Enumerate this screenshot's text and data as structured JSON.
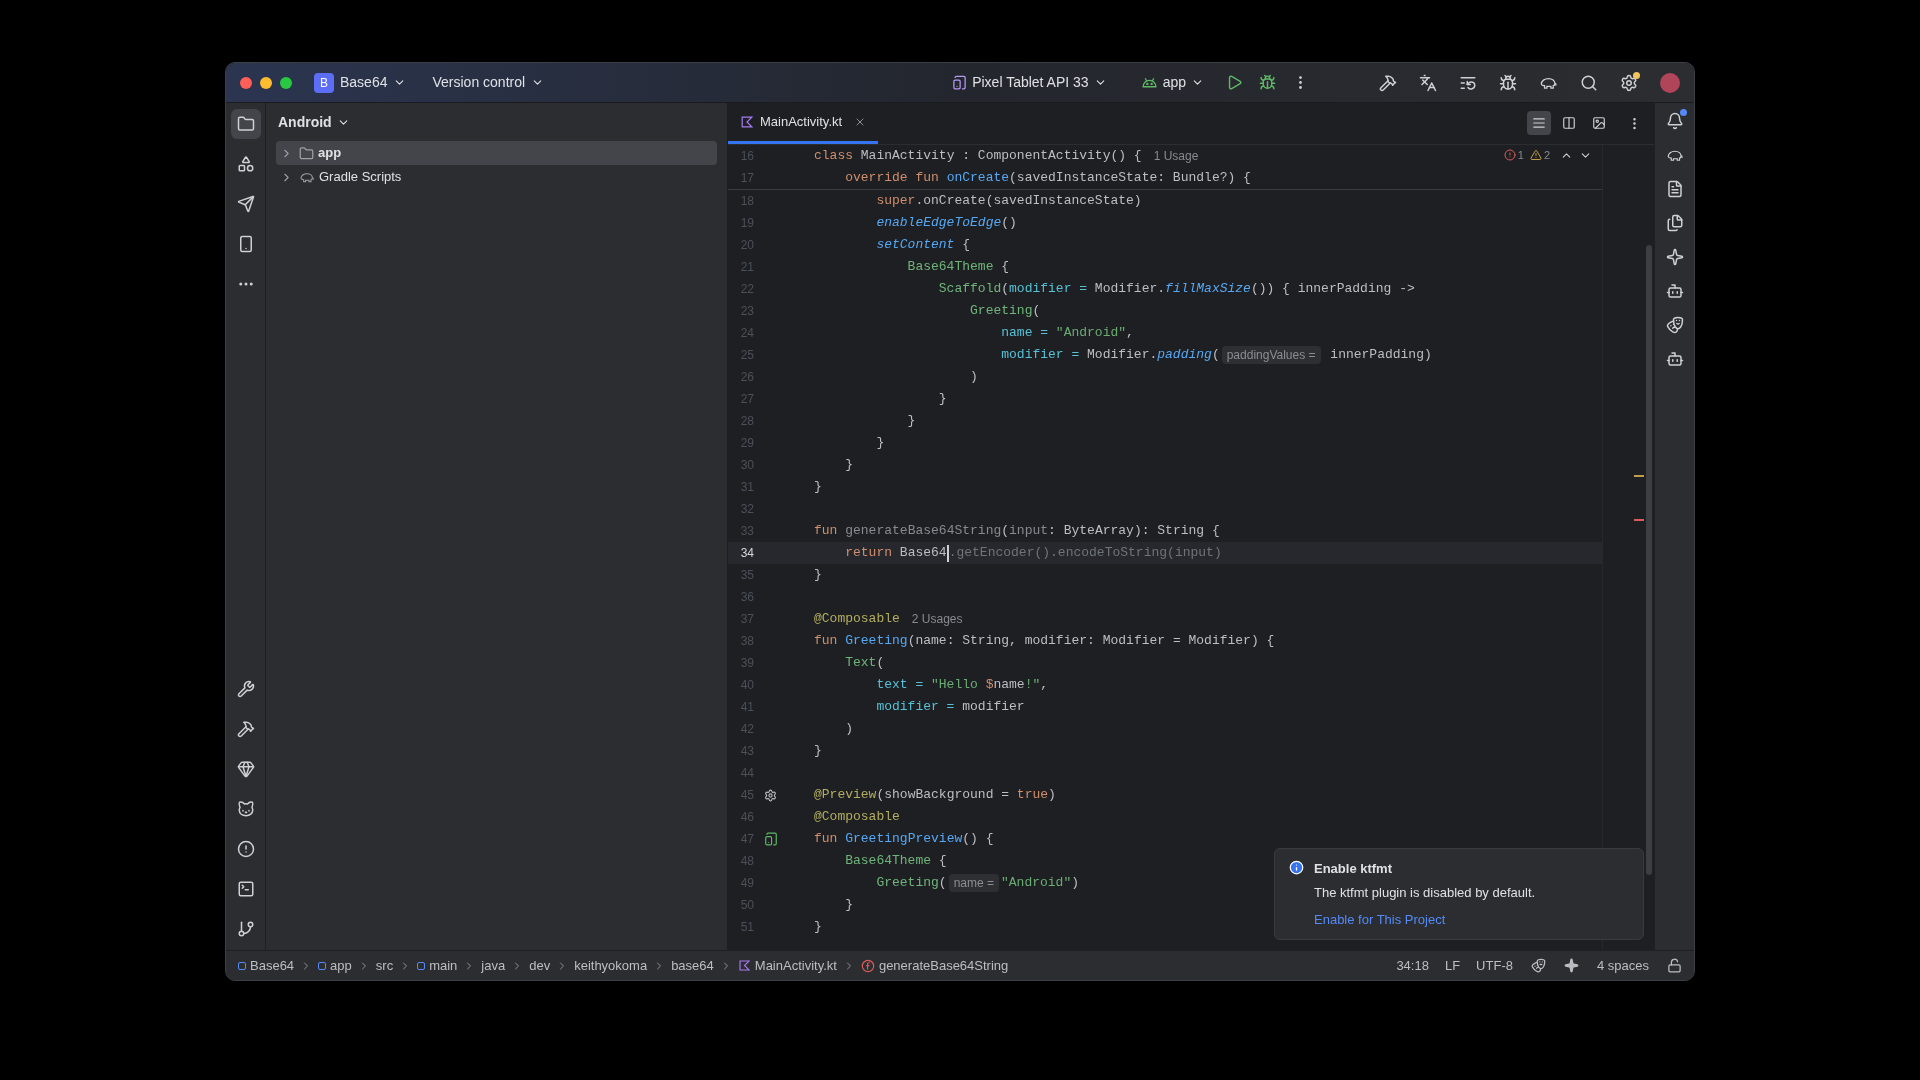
{
  "window": {
    "project": {
      "badge": "B",
      "name": "Base64"
    },
    "vcs": "Version control",
    "device": "Pixel Tablet API 33",
    "run_config": "app"
  },
  "left_strip": {
    "top": [
      {
        "kind": "project",
        "selected": true
      },
      {
        "kind": "resources",
        "selected": false
      },
      {
        "kind": "commit",
        "selected": false
      },
      {
        "kind": "device",
        "selected": false
      },
      {
        "kind": "more",
        "selected": false
      }
    ],
    "bottom": [
      {
        "kind": "build",
        "selected": false
      },
      {
        "kind": "hammer",
        "selected": false
      },
      {
        "kind": "gem",
        "selected": false
      },
      {
        "kind": "cat",
        "selected": false
      },
      {
        "kind": "problems",
        "selected": false
      },
      {
        "kind": "terminal",
        "selected": false
      },
      {
        "kind": "git",
        "selected": false
      }
    ]
  },
  "right_strip": [
    {
      "kind": "notifications",
      "badge": true
    },
    {
      "kind": "gradle",
      "badge": false
    },
    {
      "kind": "device_manager",
      "badge": false
    },
    {
      "kind": "files",
      "badge": false
    },
    {
      "kind": "gemini",
      "badge": false
    },
    {
      "kind": "bot",
      "badge": false
    },
    {
      "kind": "copilot",
      "badge": false
    },
    {
      "kind": "copilot_chat",
      "badge": false
    }
  ],
  "project_panel": {
    "title": "Android",
    "tree": [
      {
        "label": "app",
        "kind": "module",
        "selected": true,
        "expanded": false
      },
      {
        "label": "Gradle Scripts",
        "kind": "gradle",
        "selected": false,
        "expanded": false
      }
    ]
  },
  "editor": {
    "tabs": [
      {
        "label": "MainActivity.kt",
        "selected": true
      }
    ],
    "view_modes": [
      {
        "kind": "code",
        "selected": true
      },
      {
        "kind": "split",
        "selected": false
      },
      {
        "kind": "design",
        "selected": false
      }
    ],
    "inspections": {
      "errors": "1",
      "warnings": "2"
    },
    "sticky_lines": [
      {
        "number": "16",
        "tokens": [
          {
            "kind": "kw",
            "text": "class "
          },
          {
            "kind": "plain",
            "text": "MainActivity : ComponentActivity() {"
          },
          {
            "kind": "usage",
            "text": "1 Usage"
          }
        ]
      },
      {
        "number": "17",
        "tokens": [
          {
            "kind": "kw",
            "text": "    override fun "
          },
          {
            "kind": "fdecl",
            "text": "onCreate"
          },
          {
            "kind": "plain",
            "text": "(savedInstanceState: Bundle?) {"
          }
        ]
      }
    ],
    "lines": [
      {
        "number": "18",
        "current": false,
        "tokens": [
          {
            "kind": "kw",
            "text": "        super"
          },
          {
            "kind": "plain",
            "text": ".onCreate(savedInstanceState)"
          }
        ]
      },
      {
        "number": "19",
        "current": false,
        "tokens": [
          {
            "kind": "fcall",
            "text": "        enableEdgeToEdge"
          },
          {
            "kind": "plain",
            "text": "()"
          }
        ]
      },
      {
        "number": "20",
        "current": false,
        "tokens": [
          {
            "kind": "fcall",
            "text": "        setContent"
          },
          {
            "kind": "plain",
            "text": " {"
          }
        ]
      },
      {
        "number": "21",
        "current": false,
        "tokens": [
          {
            "kind": "comp",
            "text": "            Base64Theme"
          },
          {
            "kind": "plain",
            "text": " {"
          }
        ]
      },
      {
        "number": "22",
        "current": false,
        "tokens": [
          {
            "kind": "comp",
            "text": "                Scaffold"
          },
          {
            "kind": "plain",
            "text": "("
          },
          {
            "kind": "arg",
            "text": "modifier ="
          },
          {
            "kind": "plain",
            "text": " Modifier."
          },
          {
            "kind": "fcall",
            "text": "fillMaxSize"
          },
          {
            "kind": "plain",
            "text": "()) { innerPadding ->"
          }
        ]
      },
      {
        "number": "23",
        "current": false,
        "tokens": [
          {
            "kind": "comp",
            "text": "                    Greeting"
          },
          {
            "kind": "plain",
            "text": "("
          }
        ]
      },
      {
        "number": "24",
        "current": false,
        "tokens": [
          {
            "kind": "arg",
            "text": "                        name ="
          },
          {
            "kind": "str",
            "text": " \"Android\""
          },
          {
            "kind": "plain",
            "text": ","
          }
        ]
      },
      {
        "number": "25",
        "current": false,
        "tokens": [
          {
            "kind": "arg",
            "text": "                        modifier ="
          },
          {
            "kind": "plain",
            "text": " Modifier."
          },
          {
            "kind": "fcall",
            "text": "padding"
          },
          {
            "kind": "plain",
            "text": "("
          },
          {
            "kind": "hint",
            "text": "paddingValues ="
          },
          {
            "kind": "plain",
            "text": " innerPadding)"
          }
        ]
      },
      {
        "number": "26",
        "current": false,
        "tokens": [
          {
            "kind": "plain",
            "text": "                    )"
          }
        ]
      },
      {
        "number": "27",
        "current": false,
        "tokens": [
          {
            "kind": "plain",
            "text": "                }"
          }
        ]
      },
      {
        "number": "28",
        "current": false,
        "tokens": [
          {
            "kind": "plain",
            "text": "            }"
          }
        ]
      },
      {
        "number": "29",
        "current": false,
        "tokens": [
          {
            "kind": "plain",
            "text": "        }"
          }
        ]
      },
      {
        "number": "30",
        "current": false,
        "tokens": [
          {
            "kind": "plain",
            "text": "    }"
          }
        ]
      },
      {
        "number": "31",
        "current": false,
        "tokens": [
          {
            "kind": "plain",
            "text": "}"
          }
        ]
      },
      {
        "number": "32",
        "current": false
      },
      {
        "number": "33",
        "current": false,
        "tokens": [
          {
            "kind": "kw",
            "text": "fun "
          },
          {
            "kind": "dim",
            "text": "generateBase64String"
          },
          {
            "kind": "plain",
            "text": "("
          },
          {
            "kind": "dim",
            "text": "input"
          },
          {
            "kind": "plain",
            "text": ": ByteArray): String {"
          }
        ]
      },
      {
        "number": "34",
        "current": true,
        "tokens": [
          {
            "kind": "kw",
            "text": "    return "
          },
          {
            "kind": "plain",
            "text": "Base64"
          },
          {
            "kind": "cursor"
          },
          {
            "kind": "gray",
            "text": ".getEncoder().encodeToString(input)"
          }
        ]
      },
      {
        "number": "35",
        "current": false,
        "tokens": [
          {
            "kind": "plain",
            "text": "}"
          }
        ]
      },
      {
        "number": "36",
        "current": false
      },
      {
        "number": "37",
        "current": false,
        "tokens": [
          {
            "kind": "ann",
            "text": "@Composable"
          },
          {
            "kind": "usage",
            "text": "2 Usages"
          }
        ]
      },
      {
        "number": "38",
        "current": false,
        "tokens": [
          {
            "kind": "kw",
            "text": "fun "
          },
          {
            "kind": "fdecl",
            "text": "Greeting"
          },
          {
            "kind": "plain",
            "text": "(name: String, modifier: Modifier = Modifier) {"
          }
        ]
      },
      {
        "number": "39",
        "current": false,
        "tokens": [
          {
            "kind": "comp",
            "text": "    Text"
          },
          {
            "kind": "plain",
            "text": "("
          }
        ]
      },
      {
        "number": "40",
        "current": false,
        "tokens": [
          {
            "kind": "arg",
            "text": "        text ="
          },
          {
            "kind": "str",
            "text": " \"Hello "
          },
          {
            "kind": "kw",
            "text": "$"
          },
          {
            "kind": "plain",
            "text": "name"
          },
          {
            "kind": "str",
            "text": "!\""
          },
          {
            "kind": "plain",
            "text": ","
          }
        ]
      },
      {
        "number": "41",
        "current": false,
        "tokens": [
          {
            "kind": "arg",
            "text": "        modifier ="
          },
          {
            "kind": "plain",
            "text": " modifier"
          }
        ]
      },
      {
        "number": "42",
        "current": false,
        "tokens": [
          {
            "kind": "plain",
            "text": "    )"
          }
        ]
      },
      {
        "number": "43",
        "current": false,
        "tokens": [
          {
            "kind": "plain",
            "text": "}"
          }
        ]
      },
      {
        "number": "44",
        "current": false
      },
      {
        "number": "45",
        "current": false,
        "gutter": {
          "kind": "settings"
        },
        "tokens": [
          {
            "kind": "ann",
            "text": "@Preview"
          },
          {
            "kind": "plain",
            "text": "(showBackground = "
          },
          {
            "kind": "kw",
            "text": "true"
          },
          {
            "kind": "plain",
            "text": ")"
          }
        ]
      },
      {
        "number": "46",
        "current": false,
        "tokens": [
          {
            "kind": "ann",
            "text": "@Composable"
          }
        ]
      },
      {
        "number": "47",
        "current": false,
        "gutter": {
          "kind": "preview"
        },
        "tokens": [
          {
            "kind": "kw",
            "text": "fun "
          },
          {
            "kind": "fdecl",
            "text": "GreetingPreview"
          },
          {
            "kind": "plain",
            "text": "() {"
          }
        ]
      },
      {
        "number": "48",
        "current": false,
        "tokens": [
          {
            "kind": "comp",
            "text": "    Base64Theme"
          },
          {
            "kind": "plain",
            "text": " {"
          }
        ]
      },
      {
        "number": "49",
        "current": false,
        "tokens": [
          {
            "kind": "comp",
            "text": "        Greeting"
          },
          {
            "kind": "plain",
            "text": "("
          },
          {
            "kind": "hint",
            "text": "name ="
          },
          {
            "kind": "str",
            "text": "\"Android\""
          },
          {
            "kind": "plain",
            "text": ")"
          }
        ]
      },
      {
        "number": "50",
        "current": false,
        "tokens": [
          {
            "kind": "plain",
            "text": "    }"
          }
        ]
      },
      {
        "number": "51",
        "current": false,
        "tokens": [
          {
            "kind": "plain",
            "text": "}"
          }
        ]
      }
    ]
  },
  "notification": {
    "title": "Enable ktfmt",
    "message": "The ktfmt plugin is disabled by default.",
    "action": "Enable for This Project"
  },
  "status_bar": {
    "breadcrumbs": [
      {
        "label": "Base64",
        "kind": "module"
      },
      {
        "label": "app",
        "kind": "module"
      },
      {
        "label": "src",
        "kind": "folder"
      },
      {
        "label": "main",
        "kind": "module"
      },
      {
        "label": "java",
        "kind": "folder"
      },
      {
        "label": "dev",
        "kind": "folder"
      },
      {
        "label": "keithyokoma",
        "kind": "folder"
      },
      {
        "label": "base64",
        "kind": "folder"
      },
      {
        "label": "MainActivity.kt",
        "kind": "kotlin"
      },
      {
        "label": "generateBase64String",
        "kind": "function"
      }
    ],
    "position": "34:18",
    "line_separator": "LF",
    "encoding": "UTF-8",
    "indent": "4 spaces"
  }
}
